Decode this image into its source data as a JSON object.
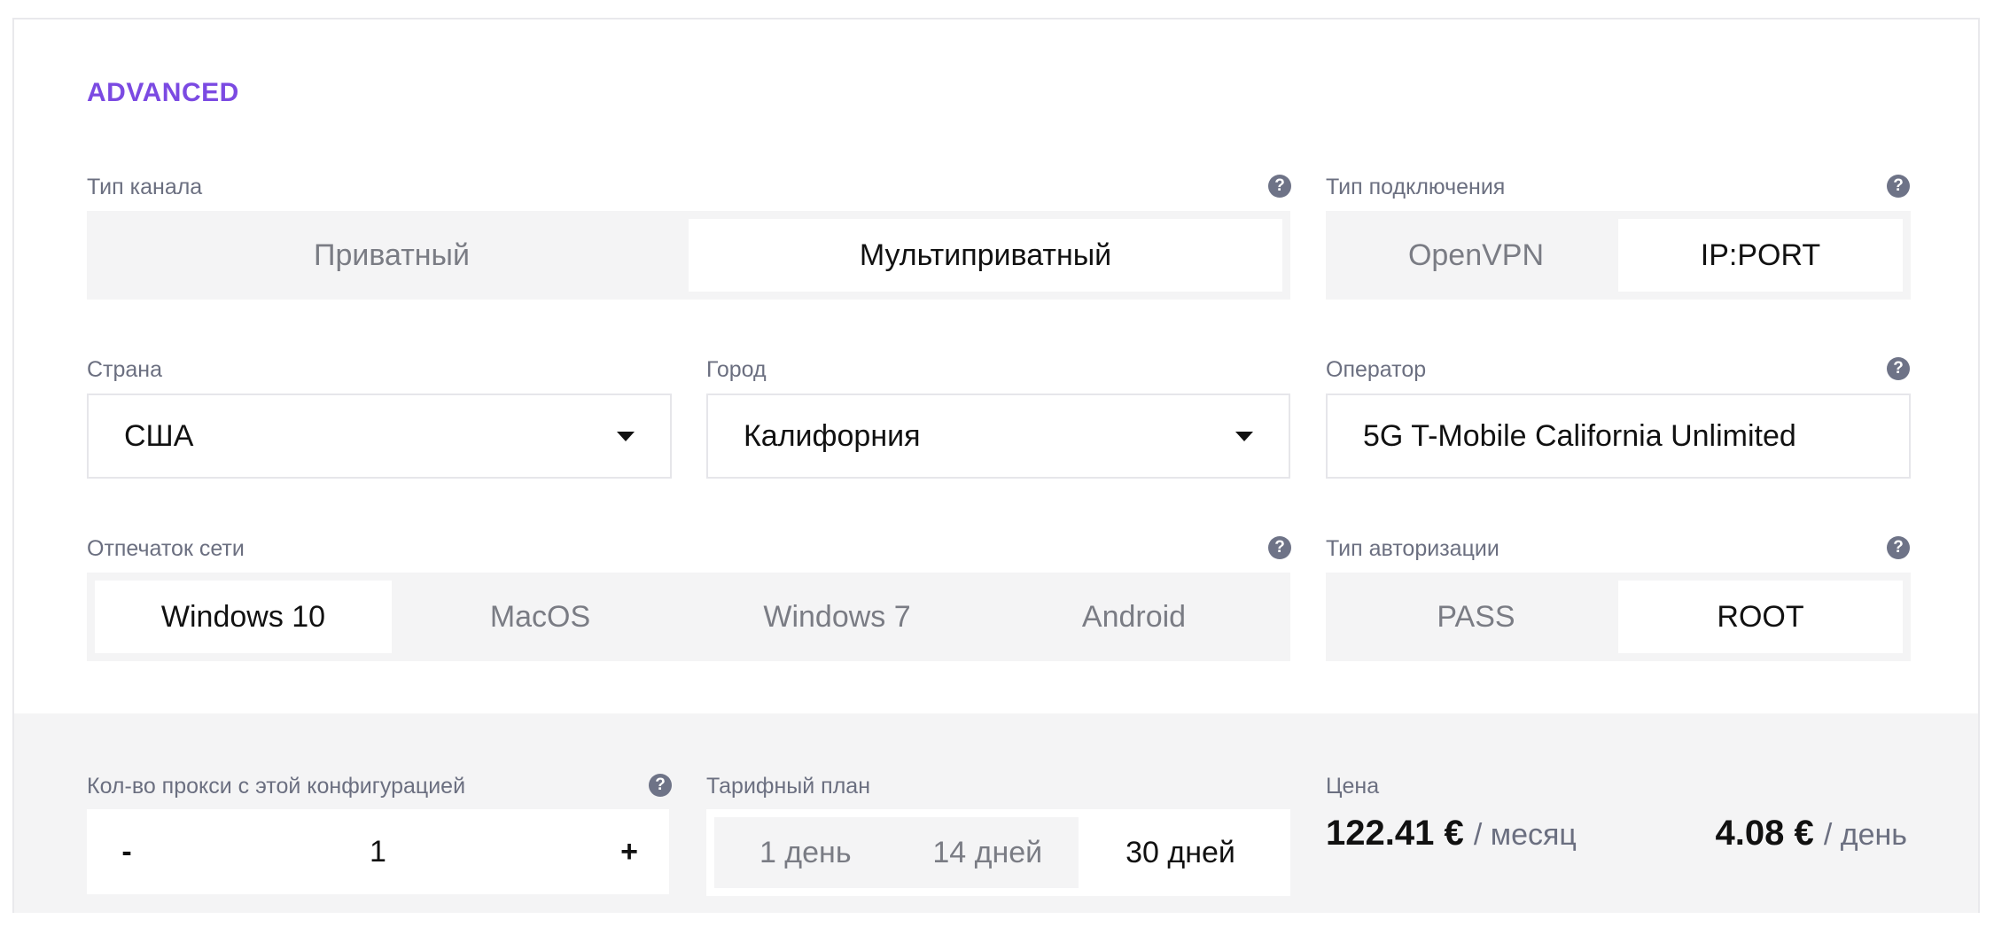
{
  "section_title": "ADVANCED",
  "channel": {
    "label": "Тип канала",
    "options": [
      "Приватный",
      "Мультиприватный"
    ],
    "selected": "Мультиприватный"
  },
  "connection": {
    "label": "Тип подключения",
    "options": [
      "OpenVPN",
      "IP:PORT"
    ],
    "selected": "IP:PORT"
  },
  "country": {
    "label": "Страна",
    "value": "США"
  },
  "city": {
    "label": "Город",
    "value": "Калифорния"
  },
  "operator": {
    "label": "Оператор",
    "value": "5G T-Mobile California Unlimited"
  },
  "fingerprint": {
    "label": "Отпечаток сети",
    "options": [
      "Windows 10",
      "MacOS",
      "Windows 7",
      "Android"
    ],
    "selected": "Windows 10"
  },
  "auth": {
    "label": "Тип авторизации",
    "options": [
      "PASS",
      "ROOT"
    ],
    "selected": "ROOT"
  },
  "quantity": {
    "label": "Кол-во прокси с этой конфигурацией",
    "minus": "-",
    "value": "1",
    "plus": "+"
  },
  "plan": {
    "label": "Тарифный план",
    "options": [
      "1 день",
      "14 дней",
      "30 дней"
    ],
    "selected": "30 дней"
  },
  "price": {
    "label": "Цена",
    "monthly_amount": "122.41 €",
    "monthly_unit": "/ месяц",
    "daily_amount": "4.08 €",
    "daily_unit": "/ день"
  },
  "help_glyph": "?",
  "icons": {
    "help": "question-circle-icon",
    "dropdown": "caret-down-icon"
  },
  "colors": {
    "accent": "#7b4ae2",
    "muted": "#6b6f80",
    "segment_bg": "#f4f4f5"
  }
}
